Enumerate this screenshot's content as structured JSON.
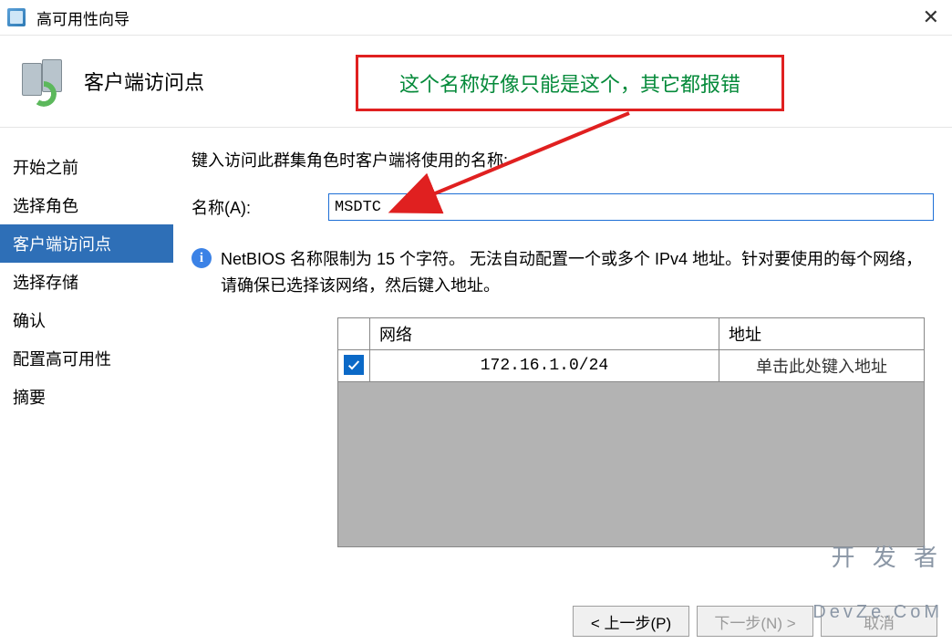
{
  "window": {
    "title": "高可用性向导",
    "header": "客户端访问点"
  },
  "sidebar": {
    "steps": [
      {
        "label": "开始之前"
      },
      {
        "label": "选择角色"
      },
      {
        "label": "客户端访问点"
      },
      {
        "label": "选择存储"
      },
      {
        "label": "确认"
      },
      {
        "label": "配置高可用性"
      },
      {
        "label": "摘要"
      }
    ],
    "active_index": 2
  },
  "main": {
    "prompt": "键入访问此群集角色时客户端将使用的名称:",
    "name_label": "名称(A):",
    "name_value": "MSDTC",
    "note": "NetBIOS 名称限制为 15 个字符。 无法自动配置一个或多个 IPv4 地址。针对要使用的每个网络，请确保已选择该网络，然后键入地址。",
    "table": {
      "col_check": "",
      "col_network": "网络",
      "col_address": "地址",
      "rows": [
        {
          "checked": true,
          "network": "172.16.1.0/24",
          "address": "单击此处键入地址"
        }
      ]
    }
  },
  "buttons": {
    "prev": "< 上一步(P)",
    "next": "下一步(N) >",
    "cancel": "取消"
  },
  "annotation": {
    "text": "这个名称好像只能是这个，其它都报错"
  },
  "watermark": {
    "line1": "开 发 者",
    "line2": "DevZe.CoM"
  }
}
